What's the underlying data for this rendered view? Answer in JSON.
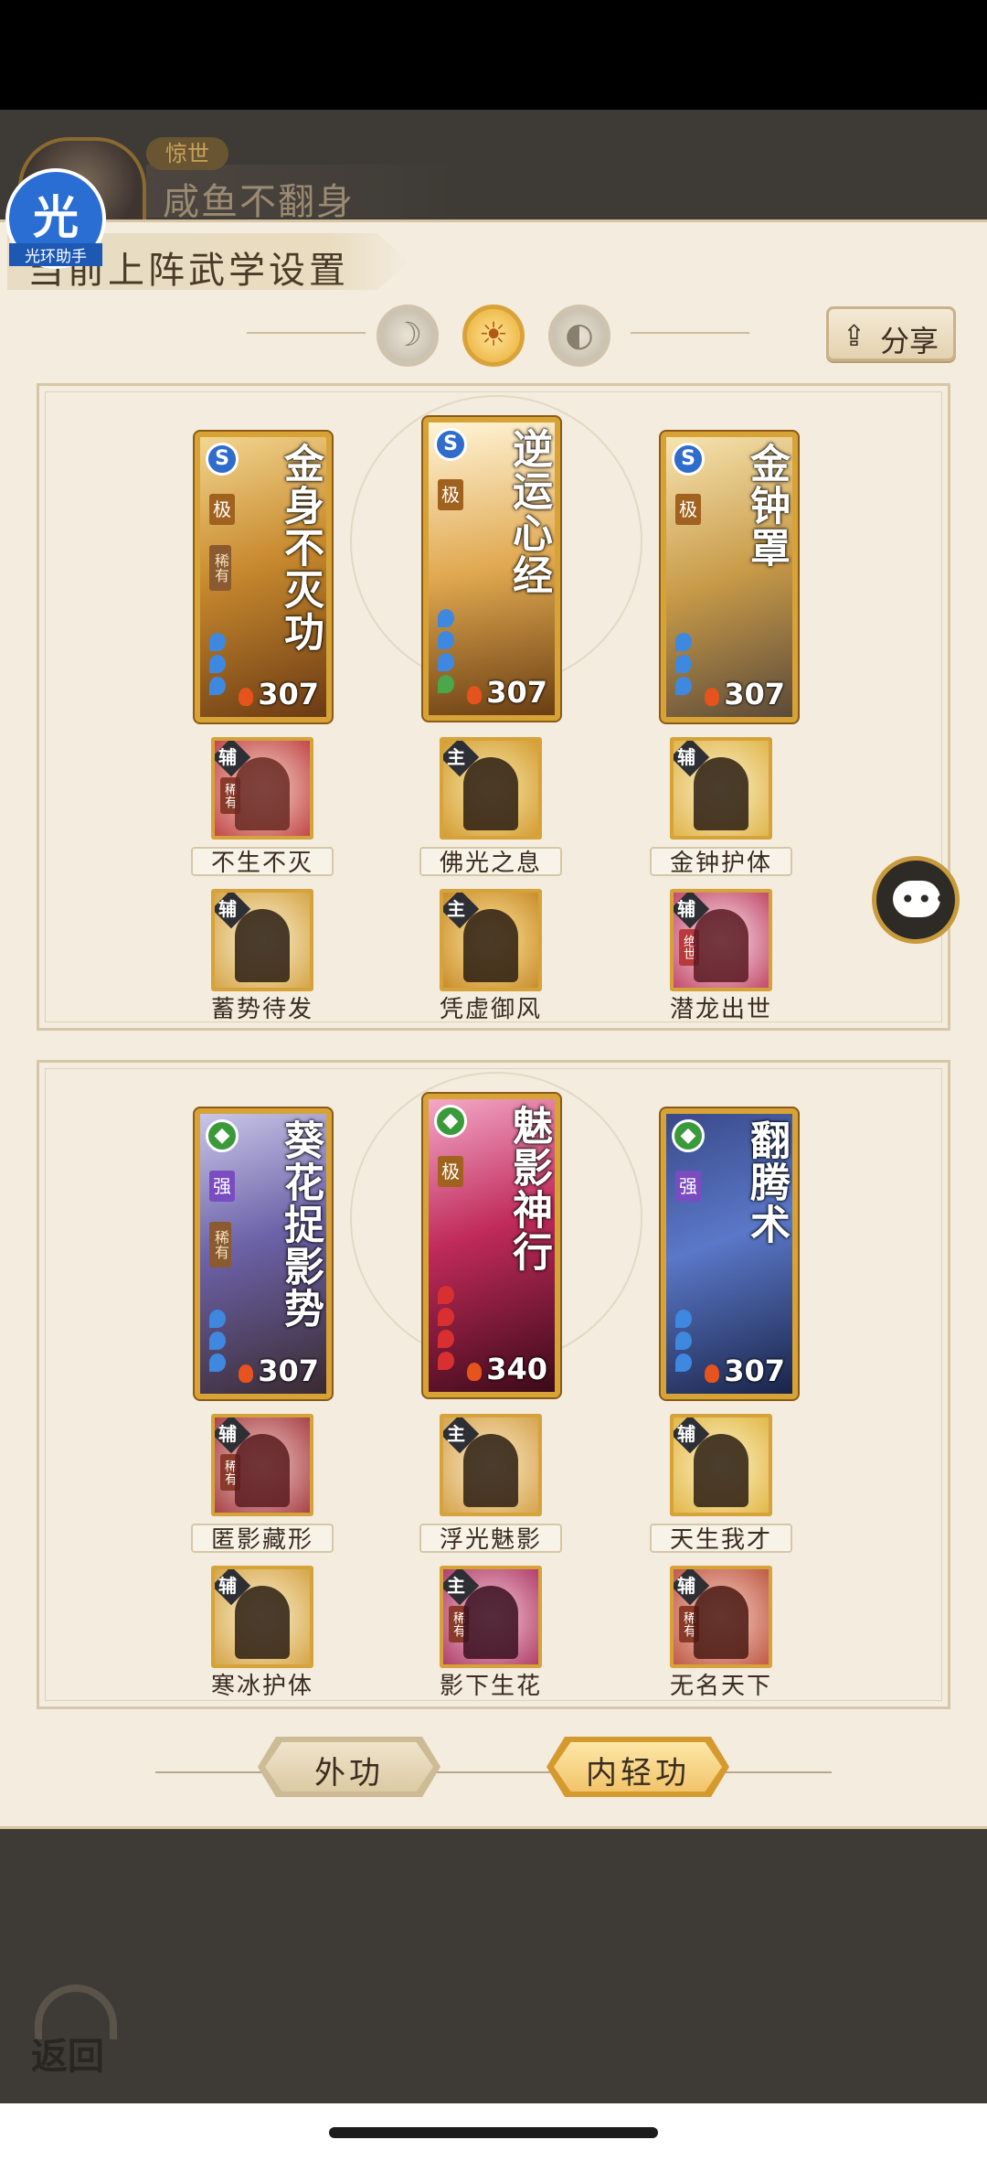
{
  "profile": {
    "rank": "惊世",
    "name": "咸鱼不翻身"
  },
  "panel": {
    "title": "当前上阵武学设置",
    "share_label": "分享",
    "share_icon": "share-icon"
  },
  "helper": {
    "char": "光",
    "label": "光环助手"
  },
  "setting_dots": [
    {
      "glyph": "☽",
      "active": false
    },
    {
      "glyph": "☀",
      "active": true
    },
    {
      "glyph": "◐",
      "active": false
    }
  ],
  "group1": {
    "cards": [
      {
        "title": "金身不灭功",
        "type": "S",
        "grade": "极",
        "rarity": "稀有",
        "power": "307"
      },
      {
        "title": "逆运心经",
        "type": "S",
        "grade": "极",
        "rarity": "",
        "power": "307"
      },
      {
        "title": "金钟罩",
        "type": "S",
        "grade": "极",
        "rarity": "",
        "power": "307"
      }
    ],
    "subs_row1": [
      {
        "tag": "辅",
        "name": "不生不灭",
        "rarity": "稀有"
      },
      {
        "tag": "主",
        "name": "佛光之息",
        "rarity": ""
      },
      {
        "tag": "辅",
        "name": "金钟护体",
        "rarity": ""
      }
    ],
    "subs_row2": [
      {
        "tag": "辅",
        "name": "蓄势待发",
        "rarity": ""
      },
      {
        "tag": "主",
        "name": "凭虚御风",
        "rarity": ""
      },
      {
        "tag": "辅",
        "name": "潜龙出世",
        "rarity": "绝世"
      }
    ]
  },
  "group2": {
    "cards": [
      {
        "title": "葵花捉影势",
        "type": "◆",
        "grade": "强",
        "rarity": "稀有",
        "power": "307"
      },
      {
        "title": "魅影神行",
        "type": "◆",
        "grade": "极",
        "rarity": "",
        "power": "340"
      },
      {
        "title": "翻腾术",
        "type": "◆",
        "grade": "强",
        "rarity": "",
        "power": "307"
      }
    ],
    "subs_row1": [
      {
        "tag": "辅",
        "name": "匿影藏形",
        "rarity": "稀有"
      },
      {
        "tag": "主",
        "name": "浮光魅影",
        "rarity": ""
      },
      {
        "tag": "辅",
        "name": "天生我才",
        "rarity": ""
      }
    ],
    "subs_row2": [
      {
        "tag": "辅",
        "name": "寒冰护体",
        "rarity": ""
      },
      {
        "tag": "主",
        "name": "影下生花",
        "rarity": "稀有"
      },
      {
        "tag": "辅",
        "name": "无名天下",
        "rarity": "稀有"
      }
    ]
  },
  "tabs": {
    "outer": "外功",
    "inner": "内轻功"
  },
  "back_label": "返回",
  "colors": {
    "panel_bg": "#f3ecdf",
    "gold_border": "#d8a336",
    "active_tab": "#f1c46a"
  }
}
